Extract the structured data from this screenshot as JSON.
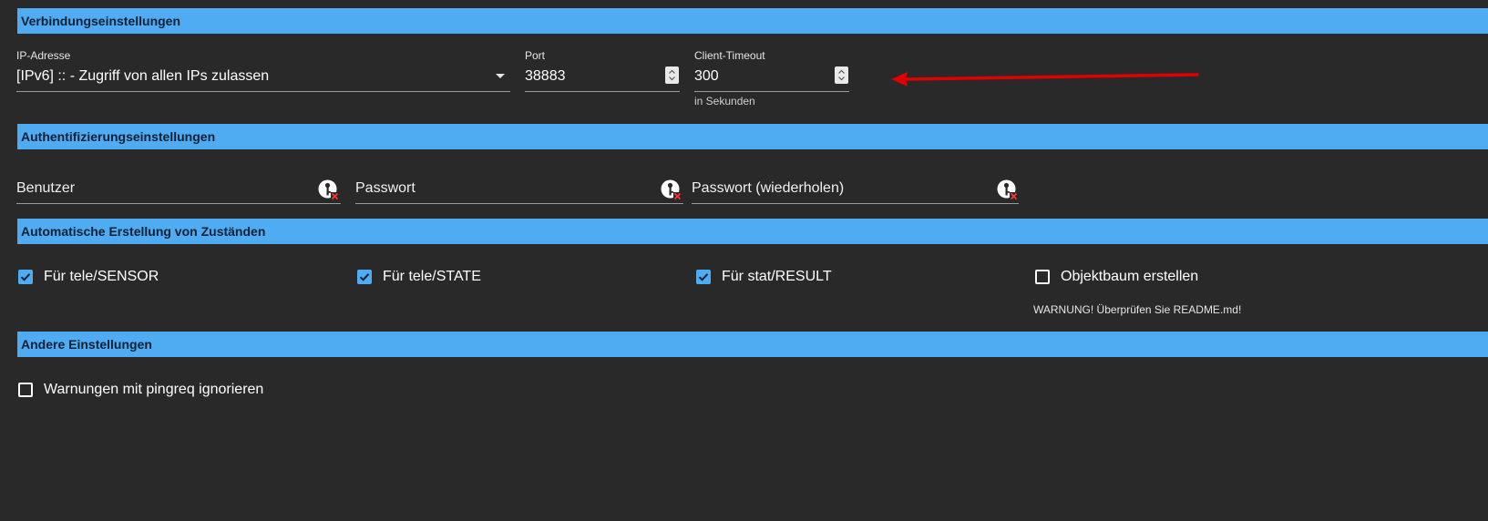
{
  "sections": {
    "connection": "Verbindungseinstellungen",
    "authentication": "Authentifizierungseinstellungen",
    "auto_states": "Automatische Erstellung von Zuständen",
    "other": "Andere Einstellungen"
  },
  "connection": {
    "ip_label": "IP-Adresse",
    "ip_value": "[IPv6] :: - Zugriff von allen IPs zulassen",
    "port_label": "Port",
    "port_value": "38883",
    "timeout_label": "Client-Timeout",
    "timeout_value": "300",
    "timeout_helper": "in Sekunden"
  },
  "auth": {
    "user_placeholder": "Benutzer",
    "password_placeholder": "Passwort",
    "password_repeat_placeholder": "Passwort (wiederholen)"
  },
  "auto_states": {
    "sensor_label": "Für tele/SENSOR",
    "sensor_checked": true,
    "state_label": "Für tele/STATE",
    "state_checked": true,
    "result_label": "Für stat/RESULT",
    "result_checked": true,
    "objecttree_label": "Objektbaum erstellen",
    "objecttree_checked": false,
    "objecttree_warning": "WARNUNG! Überprüfen Sie README.md!"
  },
  "other": {
    "pingreq_label": "Warnungen mit pingreq ignorieren",
    "pingreq_checked": false
  },
  "colors": {
    "background": "#292929",
    "section_header": "#4fabf2",
    "checkbox_accent": "#4fabf2",
    "annotation_arrow": "#e00000"
  },
  "icons": {
    "select_caret": "chevron-down-icon",
    "spinner": "spinner-updown-icon",
    "key_clear": "key-clear-icon",
    "checkmark": "checkmark-icon"
  }
}
